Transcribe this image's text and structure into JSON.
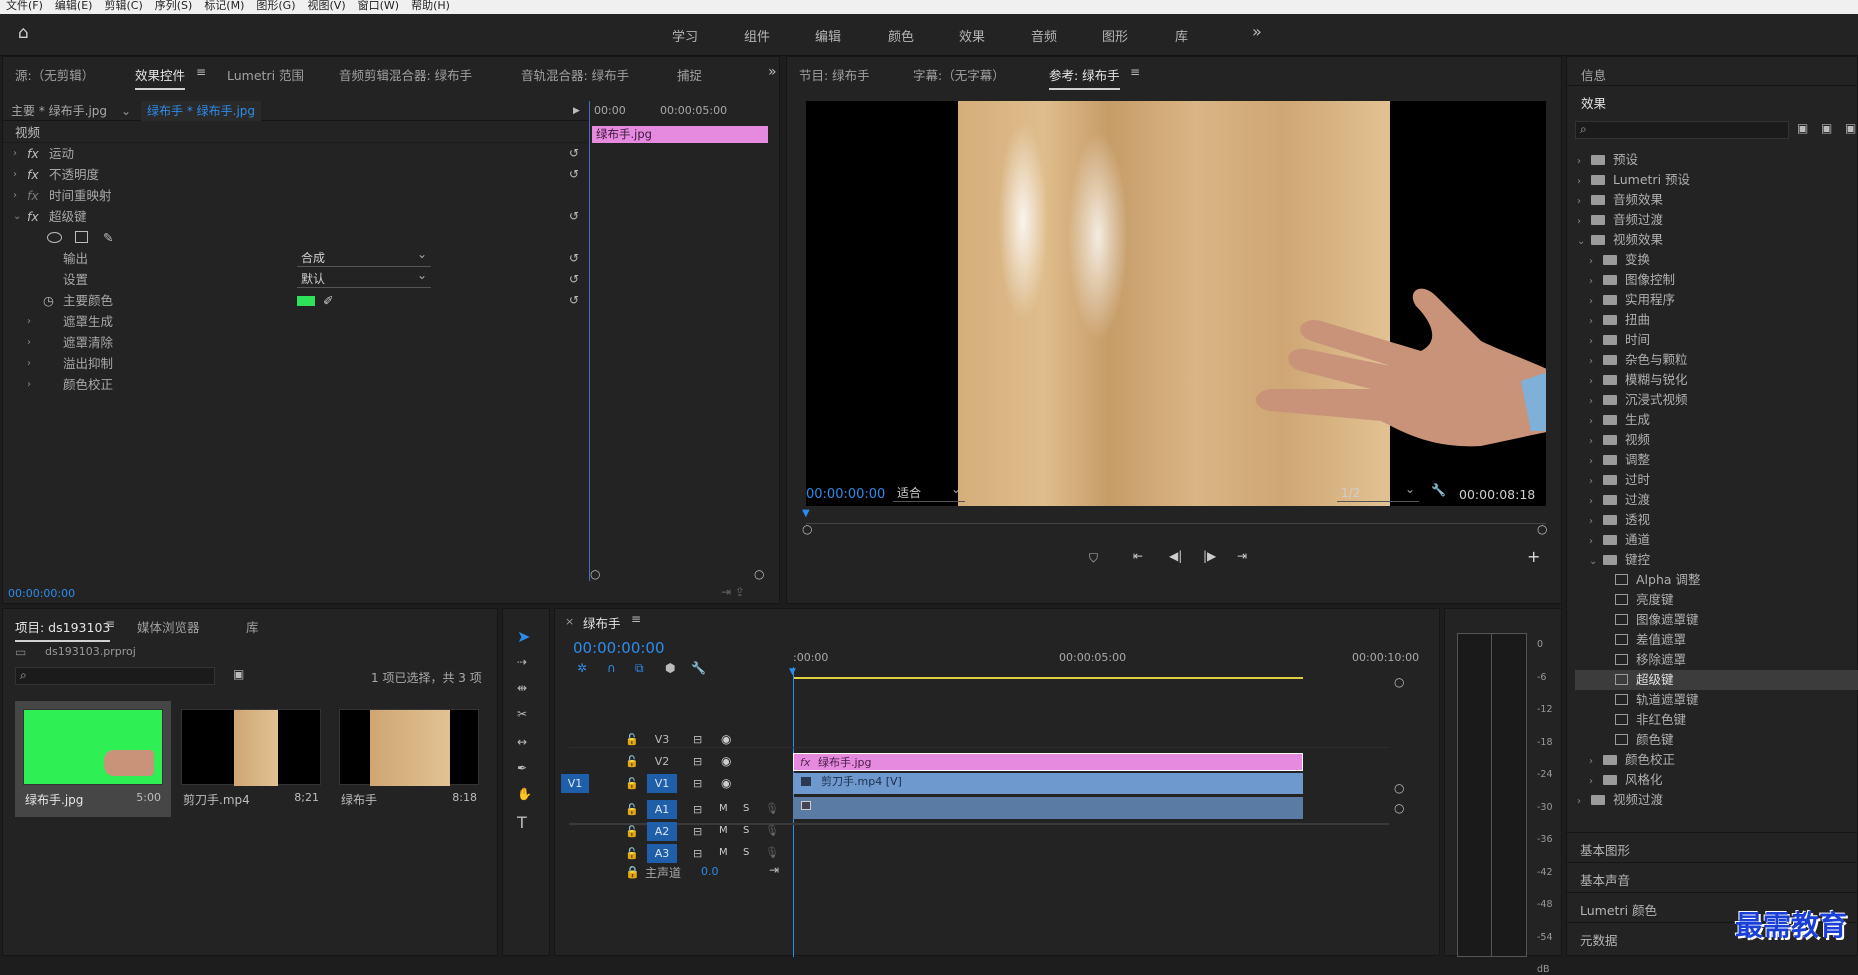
{
  "menubar": {
    "items": [
      "文件(F)",
      "编辑(E)",
      "剪辑(C)",
      "序列(S)",
      "标记(M)",
      "图形(G)",
      "视图(V)",
      "窗口(W)",
      "帮助(H)"
    ]
  },
  "workspaces": [
    "学习",
    "组件",
    "编辑",
    "颜色",
    "效果",
    "音频",
    "图形",
    "库"
  ],
  "source_panel": {
    "tabs": [
      "源:（无剪辑）",
      "效果控件",
      "Lumetri 范围",
      "音频剪辑混合器: 绿布手",
      "音轨混合器: 绿布手",
      "捕捉"
    ],
    "clip_path": "主要 * 绿布手.jpg",
    "clip_seq": "绿布手 * 绿布手.jpg",
    "ruler_start": "00:00",
    "ruler_mid": "00:00:05:00",
    "clip_label": "绿布手.jpg",
    "section": "视频",
    "effects": [
      "运动",
      "不透明度",
      "时间重映射",
      "超级键"
    ],
    "props": {
      "output_label": "输出",
      "output_value": "合成",
      "settings_label": "设置",
      "settings_value": "默认",
      "key_color_label": "主要颜色"
    },
    "sub_groups": [
      "遮罩生成",
      "遮罩清除",
      "溢出抑制",
      "颜色校正"
    ],
    "timecode": "00:00:00:00",
    "key_color": "#2ee05a"
  },
  "program_panel": {
    "tabs": [
      "节目: 绿布手",
      "字幕:（无字幕）",
      "参考: 绿布手"
    ],
    "timecode": "00:00:00:00",
    "fit": "适合",
    "resolution": "1/2",
    "duration": "00:00:08:18"
  },
  "project_panel": {
    "tabs": [
      "项目: ds193103",
      "媒体浏览器",
      "库"
    ],
    "project_file": "ds193103.prproj",
    "selection_info": "1 项已选择，共 3 项",
    "items": [
      {
        "name": "绿布手.jpg",
        "duration": "5:00"
      },
      {
        "name": "剪刀手.mp4",
        "duration": "8;21"
      },
      {
        "name": "绿布手",
        "duration": "8:18"
      }
    ]
  },
  "timeline": {
    "title": "绿布手",
    "timecode": "00:00:00:00",
    "ruler": [
      ":00:00",
      "00:00:05:00",
      "00:00:10:00"
    ],
    "tracks_video": [
      "V3",
      "V2",
      "V1"
    ],
    "tracks_audio": [
      "A1",
      "A2",
      "A3"
    ],
    "source_patch": "V1",
    "master_label": "主声道",
    "master_value": "0.0",
    "clip_v2": "绿布手.jpg",
    "clip_v1": "剪刀手.mp4 [V]",
    "mute": "M",
    "solo": "S"
  },
  "meter": {
    "scale": [
      "0",
      "-6",
      "-12",
      "-18",
      "-24",
      "-30",
      "-36",
      "-42",
      "-48",
      "-54",
      "dB"
    ]
  },
  "effects_panel": {
    "info_tab": "信息",
    "effects_tab": "效果",
    "top": [
      "预设",
      "Lumetri 预设",
      "音频效果",
      "音频过渡",
      "视频效果"
    ],
    "video_effects": [
      "变换",
      "图像控制",
      "实用程序",
      "扭曲",
      "时间",
      "杂色与颗粒",
      "模糊与锐化",
      "沉浸式视频",
      "生成",
      "视频",
      "调整",
      "过时",
      "过渡",
      "透视",
      "通道",
      "键控"
    ],
    "keying": [
      "Alpha 调整",
      "亮度键",
      "图像遮罩键",
      "差值遮罩",
      "移除遮罩",
      "超级键",
      "轨道遮罩键",
      "非红色键",
      "颜色键"
    ],
    "after": [
      "颜色校正",
      "风格化"
    ],
    "last": "视频过渡",
    "bottom_panels": [
      "基本图形",
      "基本声音",
      "Lumetri 颜色",
      "元数据"
    ]
  },
  "watermark": "最需教育"
}
